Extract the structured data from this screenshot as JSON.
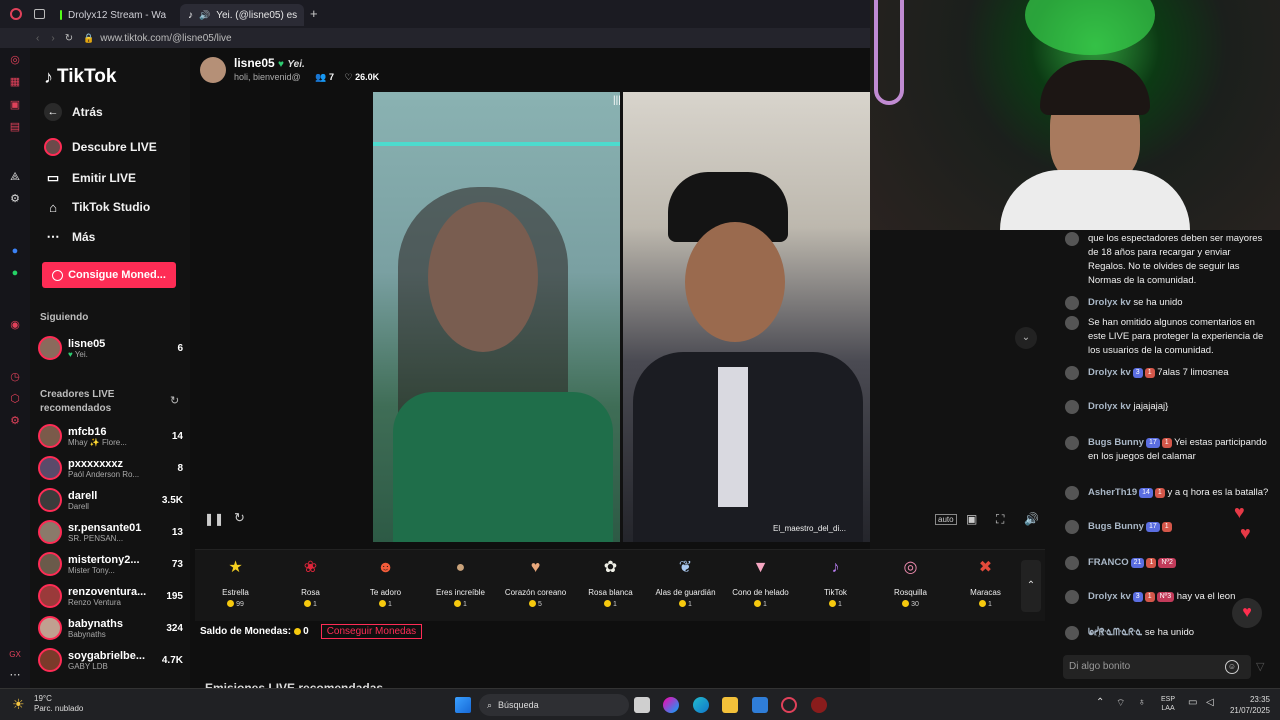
{
  "tabs": [
    {
      "label": "Drolyx12 Stream - Wa"
    },
    {
      "label": "Yei. (@lisne05) es"
    }
  ],
  "url": "www.tiktok.com/@lisne05/live",
  "sidebar": {
    "logo": "TikTok",
    "back": "Atrás",
    "descubre": "Descubre LIVE",
    "emitir": "Emitir LIVE",
    "studio": "TikTok Studio",
    "mas": "Más",
    "coins_button": "Consigue Moned...",
    "following_label": "Siguiendo",
    "following": [
      {
        "name": "lisne05",
        "sub": "Yei.",
        "count": "6"
      }
    ],
    "recommended_label_1": "Creadores LIVE",
    "recommended_label_2": "recomendados",
    "creators": [
      {
        "name": "mfcb16",
        "sub": "Mhay ✨ Flore...",
        "count": "14"
      },
      {
        "name": "pxxxxxxxz",
        "sub": "Paól Anderson Ro...",
        "count": "8"
      },
      {
        "name": "darell",
        "sub": "Darell",
        "count": "3.5K"
      },
      {
        "name": "sr.pensante01",
        "sub": "SR. PENSAN...",
        "count": "13"
      },
      {
        "name": "mistertony2...",
        "sub": "Mister Tony...",
        "count": "73"
      },
      {
        "name": "renzoventura...",
        "sub": "Renzo Ventura",
        "count": "195"
      },
      {
        "name": "babynaths",
        "sub": "Babynaths",
        "count": "324"
      },
      {
        "name": "soygabrielbe...",
        "sub": "GABY LDB",
        "count": "4.7K"
      }
    ]
  },
  "stream": {
    "host_name": "lisne05",
    "host_tag": "Yei.",
    "host_subtitle": "holi, bienvenid@",
    "viewers": "7",
    "likes": "26.0K",
    "opponent_label": "El_maestro_del_di..."
  },
  "gifts": [
    {
      "name": "Estrella",
      "price": "99",
      "icon": "star-icon",
      "color": "#f5d020"
    },
    {
      "name": "Rosa",
      "price": "1",
      "icon": "rose-icon",
      "color": "#e0253a"
    },
    {
      "name": "Te adoro",
      "price": "1",
      "icon": "heart-face-icon",
      "color": "#f25c3a"
    },
    {
      "name": "Eres increíble",
      "price": "1",
      "icon": "hamster-icon",
      "color": "#c9a27a"
    },
    {
      "name": "Corazón coreano",
      "price": "5",
      "icon": "finger-heart-icon",
      "color": "#e8a77b"
    },
    {
      "name": "Rosa blanca",
      "price": "1",
      "icon": "white-rose-icon",
      "color": "#efefe6"
    },
    {
      "name": "Alas de guardián",
      "price": "1",
      "icon": "wings-icon",
      "color": "#a9c8f0"
    },
    {
      "name": "Cono de helado",
      "price": "1",
      "icon": "ice-cream-icon",
      "color": "#f6a6c2"
    },
    {
      "name": "TikTok",
      "price": "1",
      "icon": "tiktok-icon",
      "color": "#b77cf0"
    },
    {
      "name": "Rosquilla",
      "price": "30",
      "icon": "donut-icon",
      "color": "#f08cb0"
    },
    {
      "name": "Maracas",
      "price": "1",
      "icon": "maracas-icon",
      "color": "#e24a3b"
    }
  ],
  "balance": {
    "label": "Saldo de Monedas:",
    "value": "0",
    "button": "Conseguir Monedas"
  },
  "recommended_heading": "Emisiones LIVE recomendadas",
  "chat": {
    "messages": [
      {
        "name": "",
        "text": "que los espectadores deben ser mayores de 18 años para recargar y enviar Regalos. No te olvides de seguir las Normas de la comunidad."
      },
      {
        "name": "Drolyx kv",
        "text": "se ha unido"
      },
      {
        "name": "",
        "text": "Se han omitido algunos comentarios en este LIVE para proteger la experiencia de los usuarios de la comunidad."
      },
      {
        "name": "Drolyx kv",
        "badge1": "3",
        "badge2": "1",
        "text": "7alas 7 limosnea"
      },
      {
        "name": "Drolyx kv",
        "text": "jajajajaj}"
      },
      {
        "name": "Bugs Bunny",
        "badge1": "17",
        "badge2": "1",
        "text": "Yei estas participando en los juegos del calamar"
      },
      {
        "name": "AsherTh19",
        "badge1": "14",
        "badge2": "1",
        "text": "y a q hora es la batalla?"
      },
      {
        "name": "Bugs Bunny",
        "badge1": "17",
        "badge2": "1",
        "text": ""
      },
      {
        "name": "FRANCO",
        "badge1": "21",
        "badge2": "1",
        "badge3": "Nº2",
        "text": ""
      },
      {
        "name": "Drolyx kv",
        "badge1": "3",
        "badge2": "1",
        "badge3": "Nº3",
        "text": "hay va el leon"
      },
      {
        "name": "ᖚᓰ҈ᖇᓍᗰᓍᖇᓍ",
        "text": "se ha unido"
      }
    ],
    "input_placeholder": "Di algo bonito"
  },
  "taskbar": {
    "weather_temp": "19°C",
    "weather_desc": "Parc. nublado",
    "search": "Búsqueda",
    "lang1": "ESP",
    "lang2": "LAA",
    "time": "23:35",
    "date": "21/07/2025"
  }
}
